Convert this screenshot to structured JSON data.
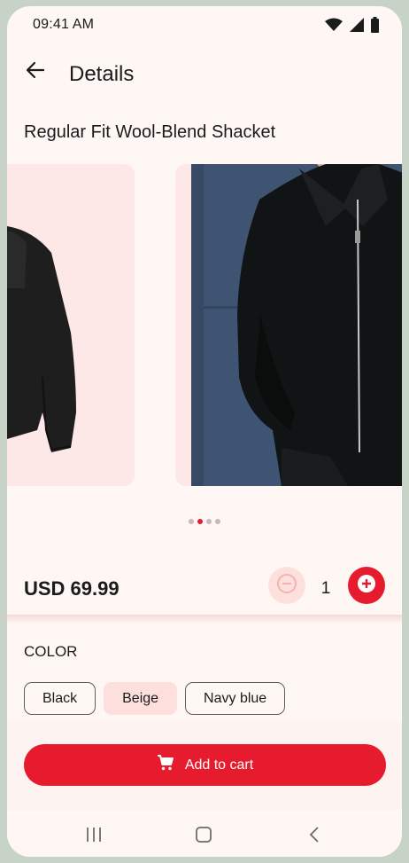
{
  "status_bar": {
    "time": "09:41 AM",
    "icons": [
      "wifi-icon",
      "cellular-signal-icon",
      "battery-icon"
    ]
  },
  "app_bar": {
    "back_icon": "arrow-left-icon",
    "title": "Details"
  },
  "product": {
    "title": "Regular Fit Wool-Blend Shacket",
    "price": "USD 69.99",
    "quantity": "1",
    "carousel": {
      "slide_count": 4,
      "active_index": 1
    }
  },
  "color": {
    "label": "COLOR",
    "options": [
      {
        "label": "Black",
        "selected": false
      },
      {
        "label": "Beige",
        "selected": true
      },
      {
        "label": "Navy blue",
        "selected": false
      }
    ]
  },
  "actions": {
    "add_to_cart_label": "Add to cart",
    "add_to_cart_icon": "cart-icon",
    "decrement_icon": "minus-circle-icon",
    "increment_icon": "plus-circle-icon"
  },
  "nav_bar": {
    "icons": [
      "recent-apps-icon",
      "home-icon",
      "back-nav-icon"
    ]
  },
  "colors": {
    "accent": "#e61c2e",
    "accent_light": "#fde0dd",
    "background": "#fff7f4",
    "slide_background": "#fde7e7"
  }
}
